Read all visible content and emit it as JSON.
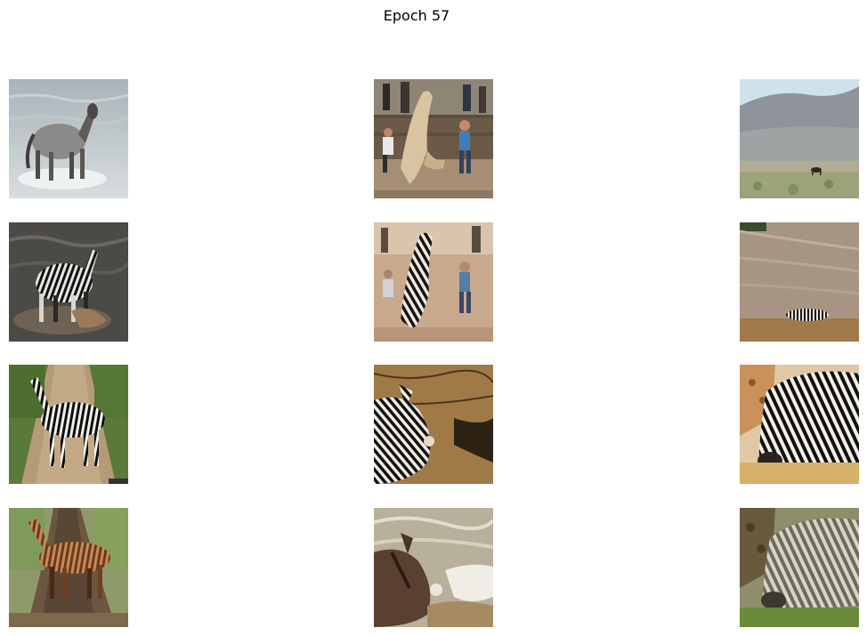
{
  "title": "Epoch 57",
  "grid": {
    "rows": 4,
    "cols": 3,
    "tiles": [
      {
        "name": "horse-splashing-water",
        "row": 0,
        "col": 0
      },
      {
        "name": "rodeo-horse-scene",
        "row": 0,
        "col": 1
      },
      {
        "name": "horse-distant-plain",
        "row": 0,
        "col": 2
      },
      {
        "name": "zebrafied-horse-splashing",
        "row": 1,
        "col": 0
      },
      {
        "name": "zebrafied-rodeo-scene",
        "row": 1,
        "col": 1
      },
      {
        "name": "zebrafied-distant-plain",
        "row": 1,
        "col": 2
      },
      {
        "name": "zebra-on-dirt-road",
        "row": 2,
        "col": 0
      },
      {
        "name": "zebra-rolling-dirt",
        "row": 2,
        "col": 1
      },
      {
        "name": "zebra-grazing-closeup",
        "row": 2,
        "col": 2
      },
      {
        "name": "horsified-zebra-road",
        "row": 3,
        "col": 0
      },
      {
        "name": "horsified-zebra-rolling",
        "row": 3,
        "col": 1
      },
      {
        "name": "horsified-zebra-closeup",
        "row": 3,
        "col": 2
      }
    ]
  }
}
